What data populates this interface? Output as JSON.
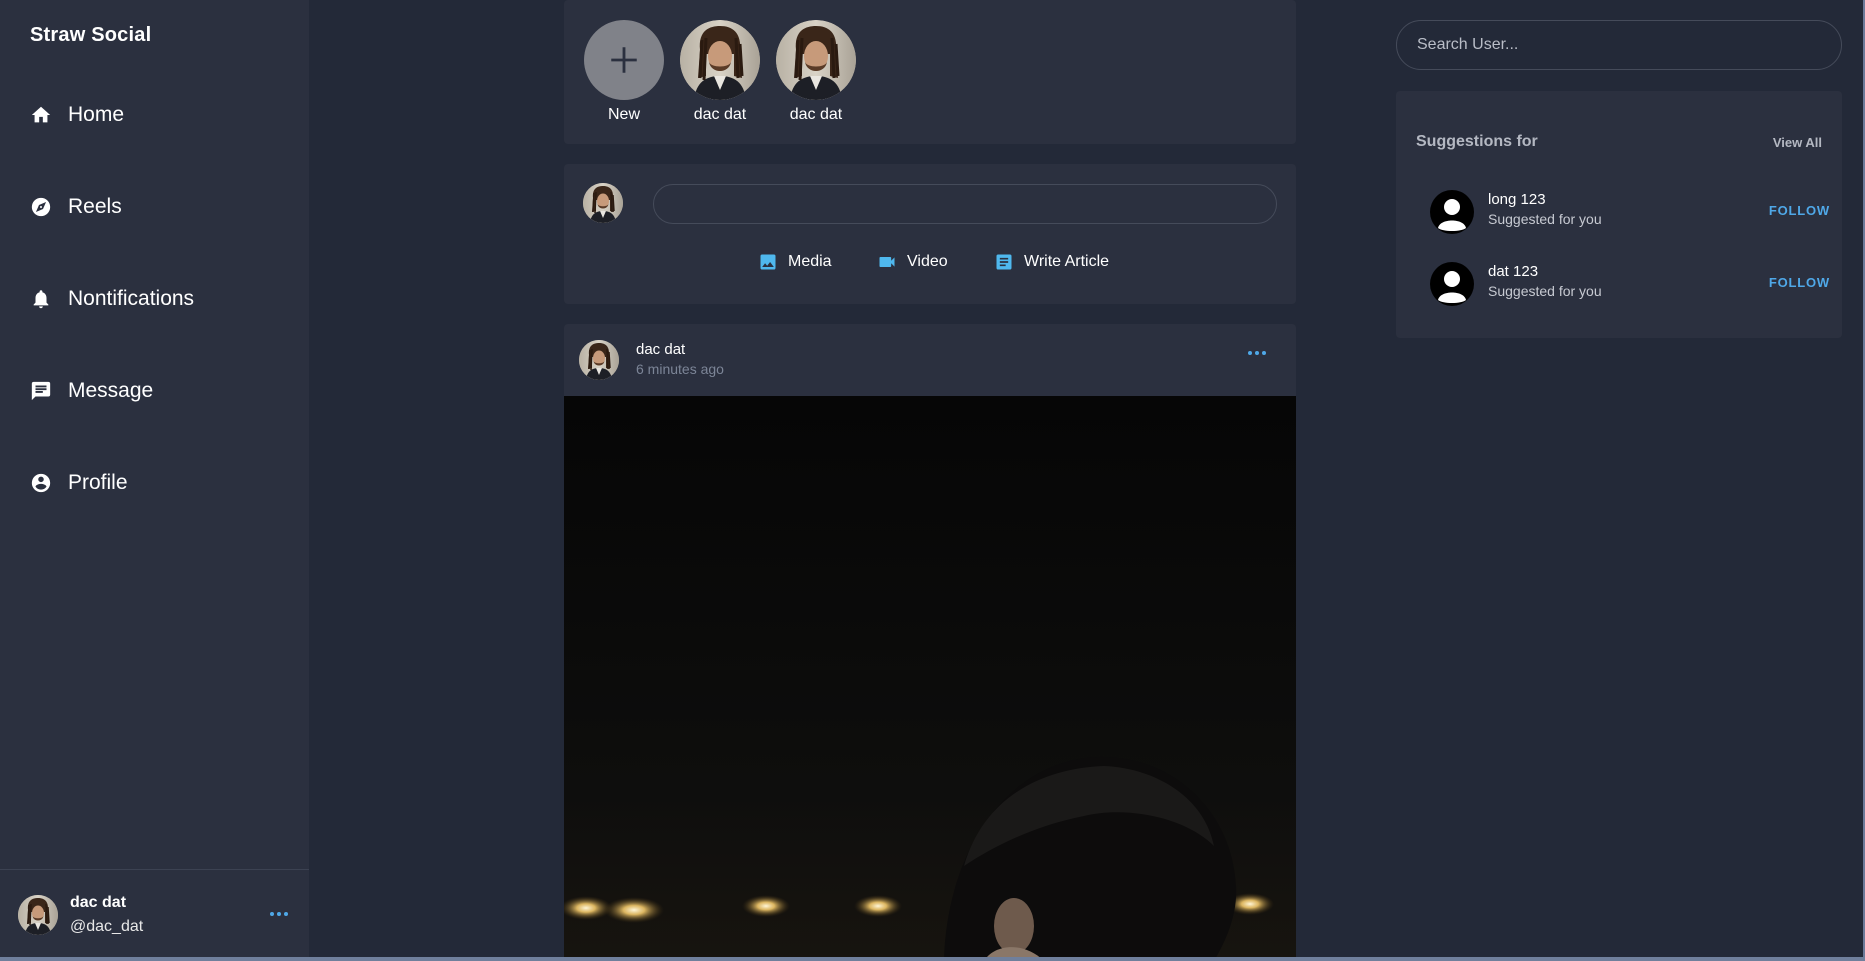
{
  "app": {
    "brand": "Straw Social"
  },
  "sidebar": {
    "items": [
      {
        "label": "Home",
        "icon": "home-icon"
      },
      {
        "label": "Reels",
        "icon": "compass-icon"
      },
      {
        "label": "Nontifications",
        "icon": "bell-icon"
      },
      {
        "label": "Message",
        "icon": "message-icon"
      },
      {
        "label": "Profile",
        "icon": "account-circle-icon"
      }
    ],
    "footer": {
      "name": "dac dat",
      "handle": "@dac_dat"
    }
  },
  "stories": [
    {
      "label": "New"
    },
    {
      "label": "dac dat"
    },
    {
      "label": "dac dat"
    }
  ],
  "composer": {
    "input_value": "",
    "actions": [
      {
        "label": "Media",
        "icon": "image-icon"
      },
      {
        "label": "Video",
        "icon": "videocam-icon"
      },
      {
        "label": "Write Article",
        "icon": "article-icon"
      }
    ]
  },
  "post": {
    "author": "dac dat",
    "time": "6 minutes ago"
  },
  "search": {
    "placeholder": "Search User..."
  },
  "suggestions": {
    "title": "Suggestions for",
    "view_all": "View All",
    "users": [
      {
        "name": "long 123",
        "subtitle": "Suggested for you",
        "action": "FOLLOW"
      },
      {
        "name": "dat 123",
        "subtitle": "Suggested for you",
        "action": "FOLLOW"
      }
    ]
  },
  "colors": {
    "background": "#232938",
    "card": "#2b303f",
    "accent": "#4fa8e8",
    "muted": "#7c8597"
  }
}
